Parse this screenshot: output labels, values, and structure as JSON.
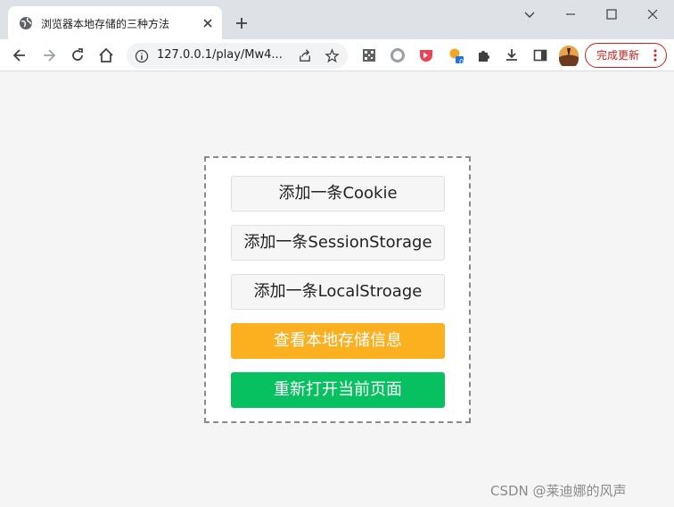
{
  "browser": {
    "tab": {
      "title": "浏览器本地存储的三种方法"
    },
    "address": {
      "url": "127.0.0.1/play/Mw4..."
    },
    "update_button": {
      "label": "完成更新"
    }
  },
  "page": {
    "buttons": [
      {
        "label": "添加一条Cookie",
        "style": "default"
      },
      {
        "label": "添加一条SessionStorage",
        "style": "default"
      },
      {
        "label": "添加一条LocalStroage",
        "style": "default"
      },
      {
        "label": "查看本地存储信息",
        "style": "warning",
        "color": "#fbb020"
      },
      {
        "label": "重新打开当前页面",
        "style": "success",
        "color": "#07c160"
      }
    ]
  },
  "watermark": {
    "text": "CSDN @莱迪娜的风声"
  },
  "extension_badge": "0",
  "icons": [
    "globe-icon",
    "close-icon",
    "plus-icon",
    "minimize-icon",
    "maximize-icon",
    "close-window-icon",
    "back-icon",
    "forward-icon",
    "reload-icon",
    "home-icon",
    "info-icon",
    "share-icon",
    "star-icon",
    "qr-code-icon",
    "circle-extension-icon",
    "pocket-icon",
    "extension-badge-icon",
    "puzzle-icon",
    "download-icon",
    "side-panel-icon",
    "avatar"
  ]
}
